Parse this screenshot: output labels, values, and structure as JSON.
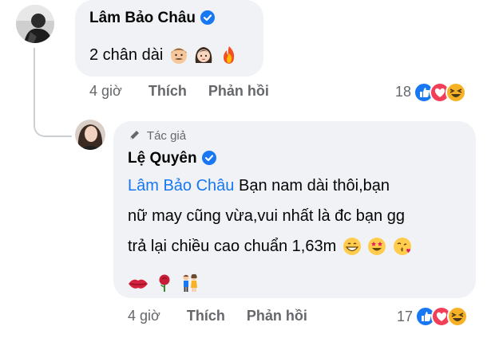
{
  "comment1": {
    "author": "Lâm Bảo Châu",
    "text": "2 chân dài",
    "emojis": [
      "man-emoji",
      "woman-emoji",
      "fire-emoji"
    ],
    "time": "4 giờ",
    "like_label": "Thích",
    "reply_label": "Phản hồi",
    "reaction_count": "18",
    "reactions": [
      "like",
      "love",
      "haha"
    ]
  },
  "reply1": {
    "badge": "Tác giả",
    "author": "Lệ Quyên",
    "mention": "Lâm Bảo Châu",
    "line1": " Bạn nam dài thôi,bạn",
    "line2": "nữ may cũng vừa,vui nhất là đc bạn gg",
    "line3": "trả lại chiều cao chuẩn 1,63m",
    "line3_emojis": [
      "grin-emoji",
      "star-struck-emoji",
      "kissing-emoji"
    ],
    "line4_emojis": [
      "lips-emoji",
      "rose-emoji",
      "couple-emoji"
    ],
    "time": "4 giờ",
    "like_label": "Thích",
    "reply_label": "Phản hồi",
    "reaction_count": "17",
    "reactions": [
      "like",
      "love",
      "haha"
    ]
  },
  "colors": {
    "bubble": "#f0f2f5",
    "mention": "#1877f2",
    "meta": "#65676b",
    "like": "#1877f2",
    "love": "#f33e58",
    "haha": "#f7b125"
  }
}
